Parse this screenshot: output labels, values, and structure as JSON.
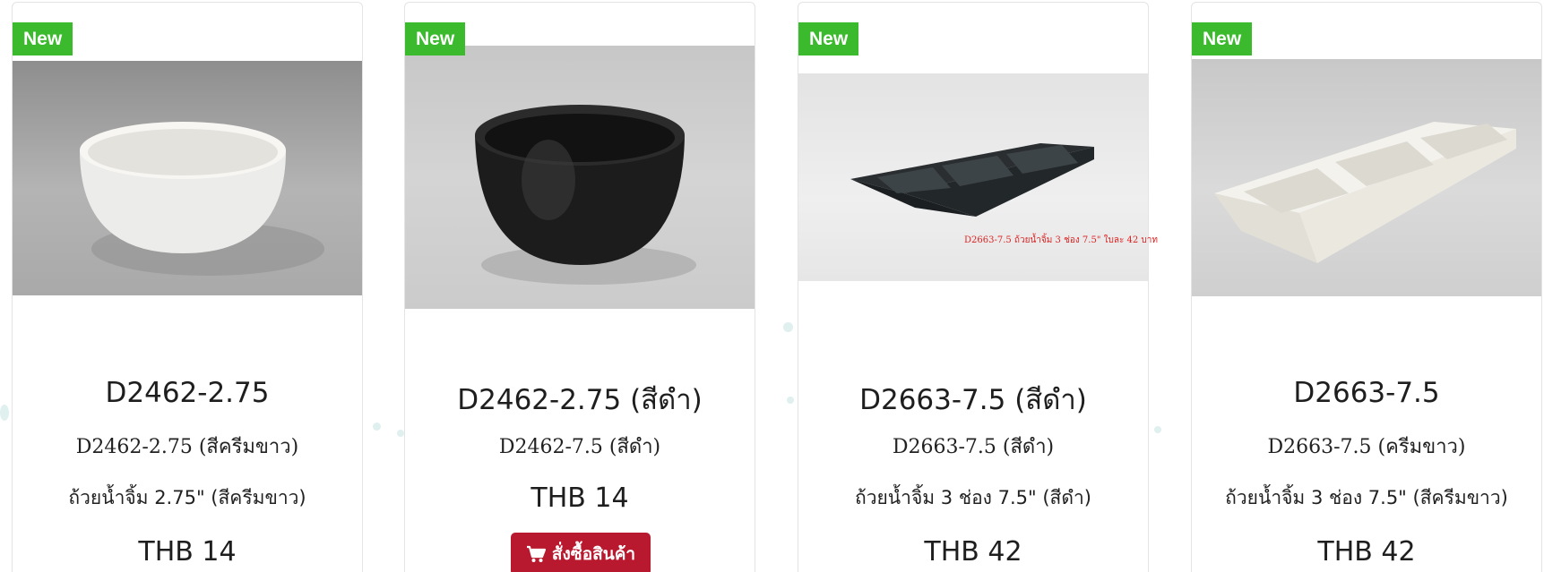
{
  "products": [
    {
      "badge": "New",
      "image_desc": "white bowl",
      "title": "D2462-2.75",
      "sku": "D2462-2.75 (สีครีมขาว)",
      "description": "ถ้วยน้ำจิ้ม 2.75\" (สีครีมขาว)",
      "price": "THB 14"
    },
    {
      "badge": "New",
      "image_desc": "black bowl",
      "title": "D2462-2.75 (สีดำ)",
      "sku": "D2462-7.5 (สีดำ)",
      "description": "",
      "price": "THB 14",
      "order_button": "สั่งซื้อสินค้า"
    },
    {
      "badge": "New",
      "image_desc": "black 3-compartment tray",
      "image_caption": "D2663-7.5  ถ้วยน้ำจิ้ม 3 ช่อง 7.5\" ใบละ 42 บาท",
      "title": "D2663-7.5 (สีดำ)",
      "sku": "D2663-7.5 (สีดำ)",
      "description": "ถ้วยน้ำจิ้ม 3 ช่อง 7.5\" (สีดำ)",
      "price": "THB 42"
    },
    {
      "badge": "New",
      "image_desc": "cream 3-compartment tray",
      "title": "D2663-7.5",
      "sku": "D2663-7.5 (ครีมขาว)",
      "description": "ถ้วยน้ำจิ้ม 3 ช่อง 7.5\" (สีครีมขาว)",
      "price": "THB 42"
    }
  ],
  "colors": {
    "badge": "#3bba2e",
    "order_button": "#b8192f",
    "card_border": "#e4e4e4"
  },
  "icons": {
    "cart": "cart-icon"
  }
}
